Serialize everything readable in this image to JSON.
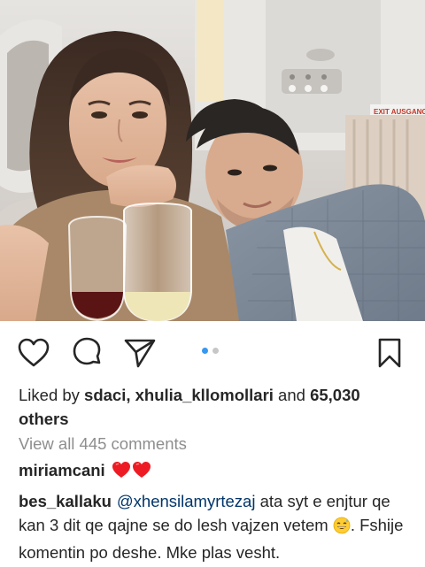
{
  "post": {
    "likes": {
      "prefix": "Liked by ",
      "user_1": "sdaci",
      "separator": ", ",
      "user_2": "xhulia_kllomollari",
      "conjunction": " and ",
      "count": "65,030",
      "suffix": "others"
    },
    "view_comments": "View all 445 comments",
    "comments": [
      {
        "username": "miriamcani",
        "text": "",
        "emoji": [
          "red-heart",
          "red-heart"
        ]
      },
      {
        "username": "bes_kallaku",
        "mention": "@xhensilamyrtezaj",
        "text": " ata syt e enjtur qe kan 3 dit qe qajne se do lesh vajzen vetem ",
        "emoji": "grinning-sweat",
        "text_after": ". Fshije komentin po deshe. Mke plas vesht."
      }
    ],
    "carousel": {
      "count": 2,
      "active_index": 0,
      "active_color": "#3897f0",
      "inactive_color": "#c7c7c7"
    }
  },
  "actions": {
    "like_icon": "heart-outline-icon",
    "comment_icon": "speech-bubble-icon",
    "share_icon": "paper-plane-icon",
    "save_icon": "bookmark-icon"
  },
  "photo": {
    "sign_text": "EXIT AUSGANG"
  },
  "colors": {
    "text": "#262626",
    "muted": "#8e8e8e",
    "mention": "#003569",
    "heart": "#ed1c24"
  }
}
